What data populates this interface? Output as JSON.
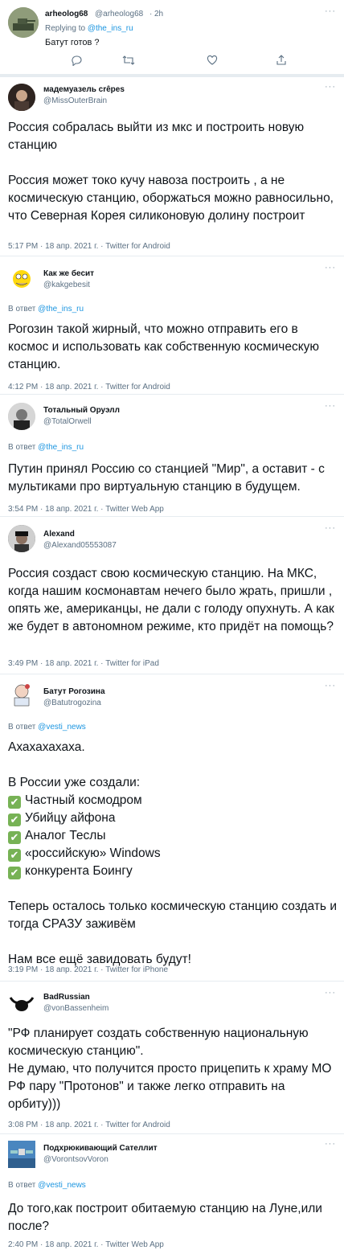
{
  "t0": {
    "name": "arheolog68",
    "handle": "@arheolog68",
    "dot": "·",
    "time": "2h",
    "replying_prefix": "Replying to ",
    "replying_to": "@the_ins_ru",
    "text": "Батут готов ?",
    "icons": [
      "reply-icon",
      "retweet-icon",
      "like-icon",
      "share-icon"
    ]
  },
  "t1": {
    "name": "мадемуазель crêpes",
    "handle": "@MissOuterBrain",
    "text": "Россия собралась выйти из мкс и построить новую станцию\n\nРоссия может токо кучу навоза построить , а не космическую станцию, оборжаться можно равносильно, что Северная Корея силиконовую долину построит",
    "meta": "5:17 PM · 18 апр. 2021 г. · Twitter for Android"
  },
  "t2": {
    "name": "Как же бесит",
    "handle": "@kakgebesit",
    "reply_prefix": "В ответ ",
    "reply_to": "@the_ins_ru",
    "text": "Рогозин такой жирный, что можно отправить его в космос и  использовать как собственную космическую станцию.",
    "meta": "4:12 PM · 18 апр. 2021 г. · Twitter for Android"
  },
  "t3": {
    "name": "Тотальный Оруэлл",
    "handle": "@TotalOrwell",
    "reply_prefix": "В ответ ",
    "reply_to": "@the_ins_ru",
    "text": "Путин принял Россию со станцией \"Мир\", а оставит - с мультиками про виртуальную станцию в будущем.",
    "meta": "3:54 PM · 18 апр. 2021 г. · Twitter Web App"
  },
  "t4": {
    "name": "Alexand",
    "handle": "@Alexand05553087",
    "text": "Россия создаст свою космическую станцию. На МКС, когда нашим космонавтам нечего было жрать, пришли , опять же, американцы, не дали с голоду опухнуть. А как же  будет в автономном режиме, кто придёт на помощь?",
    "meta": "3:49 PM · 18 апр. 2021 г. · Twitter for iPad"
  },
  "t5": {
    "name": "Батут Рогозина",
    "handle": "@Batutrogozina",
    "reply_prefix": "В ответ ",
    "reply_to": "@vesti_news",
    "line1": "Ахахахахаха.",
    "line2": "В России уже создали:",
    "items": [
      "Частный космодром",
      "Убийцу айфона",
      "Аналог Теслы",
      "«российскую» Windows",
      "конкурента Боингу"
    ],
    "check": "✔",
    "tail1": "Теперь осталось только космическую станцию создать и тогда СРАЗУ заживём",
    "tail2": "Нам все ещё завидовать будут!",
    "meta": "3:19 PM · 18 апр. 2021 г. · Twitter for iPhone"
  },
  "t6": {
    "name": "BadRussian",
    "handle": "@vonBassenheim",
    "text": "\"РФ планирует создать собственную национальную космическую станцию\".\nНе думаю, что получится просто прицепить к храму МО РФ пару \"Протонов\" и также легко отправить на орбиту)))",
    "meta": "3:08 PM · 18 апр. 2021 г. · Twitter for Android"
  },
  "t7": {
    "name": "Подхрюкивающий Сателлит",
    "handle": "@VorontsovVoron",
    "reply_prefix": "В ответ ",
    "reply_to": "@vesti_news",
    "text": "До того,как построит обитаемую станцию на Луне,или после?",
    "meta": "2:40 PM · 18 апр. 2021 г. · Twitter Web App"
  },
  "more_label": "···"
}
